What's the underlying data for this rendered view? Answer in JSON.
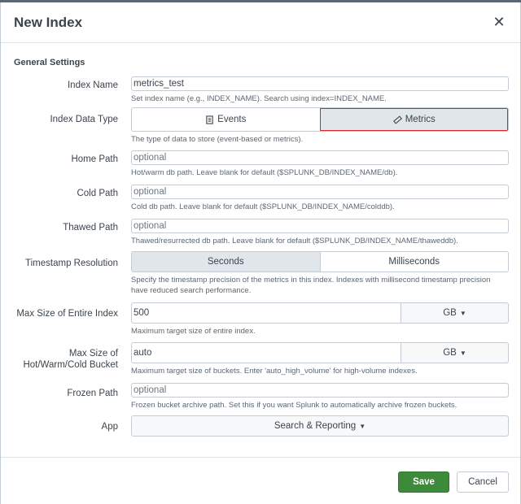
{
  "dialog": {
    "title": "New Index",
    "close_icon": "close-icon"
  },
  "section_title": "General Settings",
  "fields": {
    "index_name": {
      "label": "Index Name",
      "value": "metrics_test",
      "help": "Set index name (e.g., INDEX_NAME). Search using index=INDEX_NAME."
    },
    "index_data_type": {
      "label": "Index Data Type",
      "options": [
        {
          "label": "Events",
          "icon": "document-icon",
          "selected": false
        },
        {
          "label": "Metrics",
          "icon": "ruler-icon",
          "selected": true
        }
      ],
      "help": "The type of data to store (event-based or metrics)."
    },
    "home_path": {
      "label": "Home Path",
      "placeholder": "optional",
      "help": "Hot/warm db path. Leave blank for default ($SPLUNK_DB/INDEX_NAME/db)."
    },
    "cold_path": {
      "label": "Cold Path",
      "placeholder": "optional",
      "help": "Cold db path. Leave blank for default ($SPLUNK_DB/INDEX_NAME/colddb)."
    },
    "thawed_path": {
      "label": "Thawed Path",
      "placeholder": "optional",
      "help": "Thawed/resurrected db path. Leave blank for default ($SPLUNK_DB/INDEX_NAME/thaweddb)."
    },
    "timestamp_resolution": {
      "label": "Timestamp Resolution",
      "options": [
        {
          "label": "Seconds",
          "selected": true
        },
        {
          "label": "Milliseconds",
          "selected": false
        }
      ],
      "help": "Specify the timestamp precision of the metrics in this index. Indexes with millisecond timestamp precision have reduced search performance."
    },
    "max_size_index": {
      "label": "Max Size of Entire Index",
      "value": "500",
      "unit": "GB",
      "help": "Maximum target size of entire index."
    },
    "max_size_buckets": {
      "label_line1": "Max Size of",
      "label_line2": "Hot/Warm/Cold Bucket",
      "value": "auto",
      "unit": "GB",
      "help": "Maximum target size of buckets. Enter 'auto_high_volume' for high-volume indexes."
    },
    "frozen_path": {
      "label": "Frozen Path",
      "placeholder": "optional",
      "help": "Frozen bucket archive path. Set this if you want Splunk to automatically archive frozen buckets."
    },
    "app": {
      "label": "App",
      "value": "Search & Reporting"
    }
  },
  "footer": {
    "save_label": "Save",
    "cancel_label": "Cancel"
  },
  "colors": {
    "save_button": "#3e8a3b",
    "highlight_outline": "#d6252e",
    "selected_segment": "#e1e6eb"
  }
}
